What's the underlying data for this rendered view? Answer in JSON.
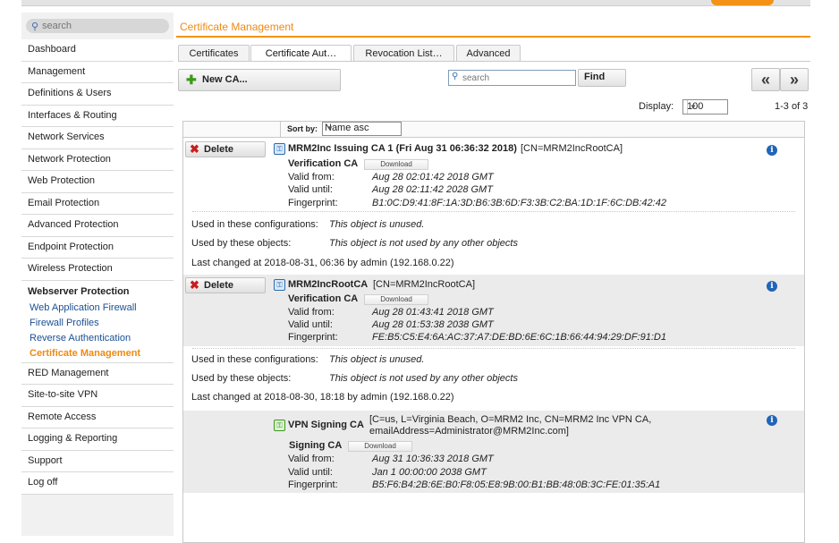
{
  "sidebar": {
    "search_placeholder": "search",
    "items": [
      {
        "label": "Dashboard"
      },
      {
        "label": "Management"
      },
      {
        "label": "Definitions & Users"
      },
      {
        "label": "Interfaces & Routing"
      },
      {
        "label": "Network Services"
      },
      {
        "label": "Network Protection"
      },
      {
        "label": "Web Protection"
      },
      {
        "label": "Email Protection"
      },
      {
        "label": "Advanced Protection"
      },
      {
        "label": "Endpoint Protection"
      },
      {
        "label": "Wireless Protection"
      },
      {
        "label": "Webserver Protection"
      },
      {
        "label": "RED Management"
      },
      {
        "label": "Site-to-site VPN"
      },
      {
        "label": "Remote Access"
      },
      {
        "label": "Logging & Reporting"
      },
      {
        "label": "Support"
      },
      {
        "label": "Log off"
      }
    ],
    "webserver_sub": [
      {
        "label": "Web Application Firewall"
      },
      {
        "label": "Firewall Profiles"
      },
      {
        "label": "Reverse Authentication"
      },
      {
        "label": "Certificate Management",
        "active": true
      }
    ]
  },
  "header": {
    "title": "Certificate Management"
  },
  "tabs": [
    {
      "label": "Certificates"
    },
    {
      "label": "Certificate Aut…",
      "active": true
    },
    {
      "label": "Revocation List…"
    },
    {
      "label": "Advanced"
    }
  ],
  "toolbar": {
    "new_label": "New CA...",
    "search_placeholder": "search",
    "find_label": "Find",
    "prev_glyph": "«",
    "next_glyph": "»",
    "display_label": "Display:",
    "display_value": "100",
    "count": "1-3 of 3",
    "sort_label": "Sort by:",
    "sort_value": "Name asc"
  },
  "entries": [
    {
      "delete_label": "Delete",
      "name": "MRM2Inc Issuing CA 1 (Fri Aug 31 06:36:32 2018)",
      "subject": "[CN=MRM2IncRootCA]",
      "type": "Verification CA",
      "download_label": "Download",
      "valid_from_label": "Valid from:",
      "valid_from": "Aug 28 02:01:42 2018 GMT",
      "valid_until_label": "Valid until:",
      "valid_until": "Aug 28 02:11:42 2028 GMT",
      "fingerprint_label": "Fingerprint:",
      "fingerprint": "B1:0C:D9:41:8F:1A:3D:B6:3B:6D:F3:3B:C2:BA:1D:1F:6C:DB:42:42",
      "used_in_label": "Used in these configurations:",
      "used_in": "This object is unused.",
      "used_by_label": "Used by these objects:",
      "used_by": "This object is not used by any other objects",
      "last_changed": "Last changed at 2018-08-31, 06:36 by admin (192.168.0.22)"
    },
    {
      "delete_label": "Delete",
      "name": "MRM2IncRootCA",
      "subject": "[CN=MRM2IncRootCA]",
      "type": "Verification CA",
      "download_label": "Download",
      "valid_from_label": "Valid from:",
      "valid_from": "Aug 28 01:43:41 2018 GMT",
      "valid_until_label": "Valid until:",
      "valid_until": "Aug 28 01:53:38 2038 GMT",
      "fingerprint_label": "Fingerprint:",
      "fingerprint": "FE:B5:C5:E4:6A:AC:37:A7:DE:BD:6E:6C:1B:66:44:94:29:DF:91:D1",
      "used_in_label": "Used in these configurations:",
      "used_in": "This object is unused.",
      "used_by_label": "Used by these objects:",
      "used_by": "This object is not used by any other objects",
      "last_changed": "Last changed at 2018-08-30, 18:18 by admin (192.168.0.22)"
    },
    {
      "name": "VPN Signing CA",
      "subject_line1": "[C=us, L=Virginia Beach, O=MRM2 Inc, CN=MRM2 Inc VPN CA,",
      "subject_line2": "emailAddress=Administrator@MRM2Inc.com]",
      "type": "Signing CA",
      "download_label": "Download",
      "valid_from_label": "Valid from:",
      "valid_from": "Aug 31 10:36:33 2018 GMT",
      "valid_until_label": "Valid until:",
      "valid_until": "Jan 1 00:00:00 2038 GMT",
      "fingerprint_label": "Fingerprint:",
      "fingerprint": "B5:F6:B4:2B:6E:B0:F8:05:E8:9B:00:B1:BB:48:0B:3C:FE:01:35:A1"
    }
  ],
  "icons": {
    "info": "i",
    "delete": "✖",
    "plus": "✚",
    "search": "⚲"
  },
  "colors": {
    "accent": "#f39214",
    "link": "#1b4f93",
    "info": "#2264b8",
    "delete": "#c81e1e"
  }
}
